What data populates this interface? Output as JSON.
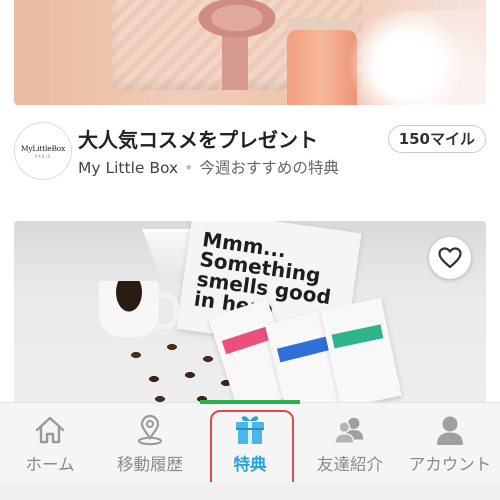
{
  "offer": {
    "title": "大人気コスメをプレゼント",
    "brand": "My Little Box",
    "tagline": "今週おすすめの特典",
    "separator": "•",
    "miles": "150マイル",
    "logo_text": "MyLittleBox",
    "logo_sub": "PARIS"
  },
  "coffee_card": {
    "box_text": "Mmm...\nSomething\nsmells good\nin here"
  },
  "bottom_nav": {
    "items": [
      {
        "label": "ホーム",
        "icon": "home-icon"
      },
      {
        "label": "移動履歴",
        "icon": "map-pin-icon"
      },
      {
        "label": "特典",
        "icon": "gift-icon",
        "active": true
      },
      {
        "label": "友達紹介",
        "icon": "friends-icon"
      },
      {
        "label": "アカウント",
        "icon": "account-icon"
      }
    ]
  },
  "colors": {
    "active_tab": "#26a4de",
    "indicator": "#27b34a",
    "highlight_border": "#e24a4a",
    "inactive_tab": "#8a8a8a"
  }
}
